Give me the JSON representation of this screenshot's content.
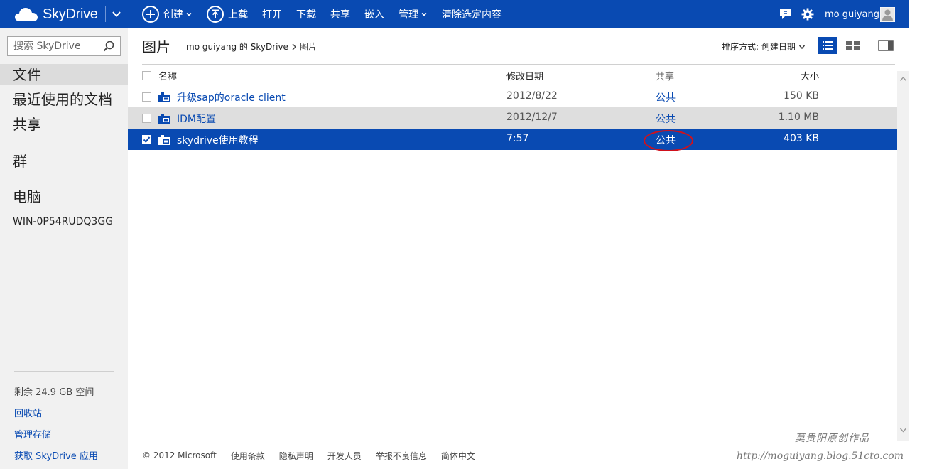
{
  "topbar": {
    "brand": "SkyDrive",
    "commands": {
      "create": "创建",
      "upload": "上载",
      "open": "打开",
      "download": "下载",
      "share": "共享",
      "embed": "嵌入",
      "manage": "管理",
      "clear": "清除选定内容"
    },
    "user_name": "mo guiyang"
  },
  "sidebar": {
    "search_placeholder": "搜索 SkyDrive",
    "nav": {
      "files": "文件",
      "recent": "最近使用的文档",
      "shared": "共享",
      "groups": "群",
      "pc": "电脑",
      "pc_name": "WIN-0P54RUDQ3GG"
    },
    "storage": "剩余 24.9 GB 空间",
    "recycle": "回收站",
    "manage_storage": "管理存储",
    "get_app": "获取 SkyDrive 应用"
  },
  "main": {
    "title": "图片",
    "breadcrumb": [
      "mo guiyang 的 SkyDrive",
      "图片"
    ],
    "sort_label": "排序方式: 创建日期",
    "columns": {
      "name": "名称",
      "date": "修改日期",
      "share": "共享",
      "size": "大小"
    },
    "rows": [
      {
        "name": "升级sap的oracle client",
        "date": "2012/8/22",
        "share": "公共",
        "size": "150 KB",
        "checked": false
      },
      {
        "name": "IDM配置",
        "date": "2012/12/7",
        "share": "公共",
        "size": "1.10 MB",
        "checked": false
      },
      {
        "name": "skydrive使用教程",
        "date": "7:57",
        "share": "公共",
        "size": "403 KB",
        "checked": true
      }
    ]
  },
  "footer": {
    "copyright": "© 2012 Microsoft",
    "terms": "使用条款",
    "privacy": "隐私声明",
    "developers": "开发人员",
    "report": "举报不良信息",
    "language": "简体中文"
  },
  "watermark": {
    "line1": "莫贵阳原创作品",
    "line2": "http://moguiyang.blog.51cto.com"
  },
  "colors": {
    "accent": "#094ab2",
    "annotation": "#d0111b",
    "sidebar_bg": "#f1f1f1"
  },
  "icons": [
    "skydrive-cloud-icon",
    "create-plus-icon",
    "upload-arrow-icon",
    "chat-icon",
    "gear-icon",
    "avatar-icon",
    "search-icon",
    "folder-icon",
    "list-view-icon",
    "thumbnail-view-icon",
    "details-pane-icon"
  ]
}
